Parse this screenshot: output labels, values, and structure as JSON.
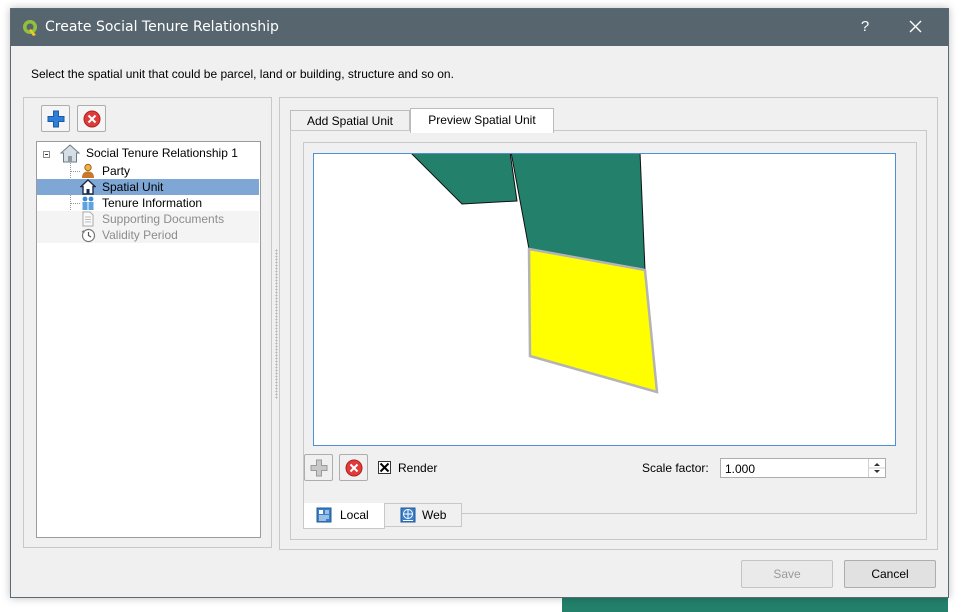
{
  "window": {
    "title": "Create Social Tenure Relationship",
    "help_label": "?",
    "instruction": "Select the spatial unit that could be parcel, land or building, structure and so on."
  },
  "tree": {
    "root_label": "Social Tenure Relationship 1",
    "items": [
      {
        "label": "Party",
        "icon": "person-icon",
        "state": "normal"
      },
      {
        "label": "Spatial Unit",
        "icon": "house-icon",
        "state": "selected"
      },
      {
        "label": "Tenure Information",
        "icon": "people-icon",
        "state": "normal"
      },
      {
        "label": "Supporting Documents",
        "icon": "document-icon",
        "state": "disabled"
      },
      {
        "label": "Validity Period",
        "icon": "clock-icon",
        "state": "disabled"
      }
    ]
  },
  "tabs": [
    {
      "label": "Add Spatial Unit",
      "active": false
    },
    {
      "label": "Preview Spatial Unit",
      "active": true
    }
  ],
  "preview": {
    "render_label": "Render",
    "render_checked": true,
    "scale_label": "Scale factor:",
    "scale_value": "1.000"
  },
  "bottom_tabs": [
    {
      "label": "Local",
      "icon": "local-icon",
      "active": true
    },
    {
      "label": "Web",
      "icon": "web-icon",
      "active": false
    }
  ],
  "buttons": {
    "save": "Save",
    "cancel": "Cancel"
  },
  "colors": {
    "titlebar": "#56656e",
    "parcel_fill": "#23806b",
    "selected_fill": "#ffff00",
    "selection": "#7fa7d6"
  }
}
